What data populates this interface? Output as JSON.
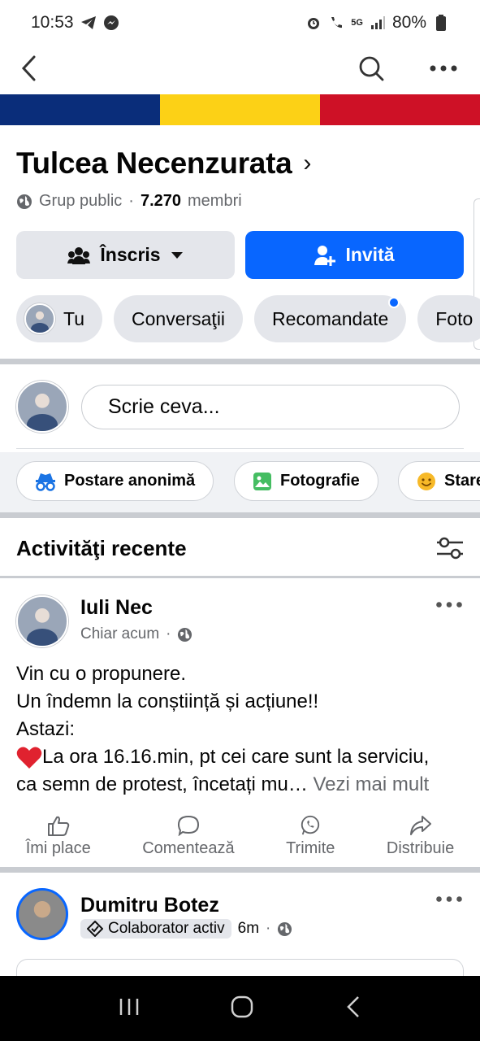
{
  "status_bar": {
    "time": "10:53",
    "battery": "80%",
    "network": "5G"
  },
  "group": {
    "name": "Tulcea Necenzurata",
    "privacy": "Grup public",
    "separator": " · ",
    "member_count": "7.270",
    "member_label": "membri",
    "cover_colors": [
      "#0a2d7a",
      "#fcd116",
      "#ce1126"
    ]
  },
  "buttons": {
    "joined": "Înscris",
    "invite": "Invită"
  },
  "chips": [
    {
      "label": "Tu"
    },
    {
      "label": "Conversaţii"
    },
    {
      "label": "Recomandate"
    },
    {
      "label": "Foto"
    }
  ],
  "composer": {
    "placeholder": "Scrie ceva..."
  },
  "post_actions": [
    "Postare anonimă",
    "Fotografie",
    "Stare"
  ],
  "recent": {
    "title": "Activităţi recente"
  },
  "posts": [
    {
      "author": "Iuli Nec",
      "time": "Chiar acum",
      "lines": [
        "Vin cu o propunere.",
        "Un îndemn la conștiință și acțiune!!",
        "Astazi:",
        "La ora 16.16.min, pt cei care sunt la serviciu,",
        "ca semn de protest, încetați mu…"
      ],
      "see_more": " Vezi mai mult",
      "actions": [
        "Îmi place",
        "Comentează",
        "Trimite",
        "Distribuie"
      ]
    },
    {
      "author": "Dumitru Botez",
      "badge": "Colaborator activ",
      "time": "6m"
    }
  ],
  "colors": {
    "accent": "#0866ff",
    "chip_bg": "#e4e6eb",
    "secondary_text": "#65676b"
  }
}
